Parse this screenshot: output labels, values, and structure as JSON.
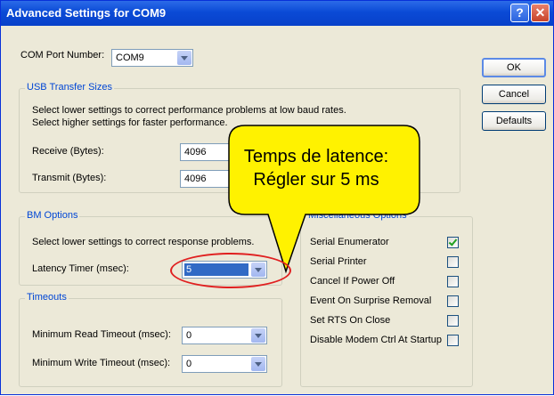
{
  "window": {
    "title": "Advanced Settings for COM9",
    "help_glyph": "?",
    "close_glyph": "✕"
  },
  "com_port": {
    "label": "COM Port Number:",
    "value": "COM9"
  },
  "buttons": {
    "ok": "OK",
    "cancel": "Cancel",
    "defaults": "Defaults"
  },
  "usb": {
    "title": "USB Transfer Sizes",
    "desc1": "Select lower settings to correct performance problems at low baud rates.",
    "desc2": "Select higher settings for faster performance.",
    "receive_label": "Receive (Bytes):",
    "receive_value": "4096",
    "transmit_label": "Transmit (Bytes):",
    "transmit_value": "4096"
  },
  "bm": {
    "title": "BM Options",
    "desc": "Select lower settings to correct response problems.",
    "latency_label": "Latency Timer (msec):",
    "latency_value": "5"
  },
  "timeouts": {
    "title": "Timeouts",
    "read_label": "Minimum Read Timeout (msec):",
    "read_value": "0",
    "write_label": "Minimum Write Timeout (msec):",
    "write_value": "0"
  },
  "misc": {
    "title": "Miscellaneous Options",
    "options": [
      {
        "label": "Serial Enumerator",
        "checked": true
      },
      {
        "label": "Serial Printer",
        "checked": false
      },
      {
        "label": "Cancel If Power Off",
        "checked": false
      },
      {
        "label": "Event On Surprise Removal",
        "checked": false
      },
      {
        "label": "Set RTS On Close",
        "checked": false
      },
      {
        "label": "Disable Modem Ctrl At Startup",
        "checked": false
      }
    ]
  },
  "callout": {
    "line1": "Temps de latence:",
    "line2": "Régler sur 5 ms",
    "fill": "#FFF200",
    "ellipse_color": "#E02020"
  }
}
